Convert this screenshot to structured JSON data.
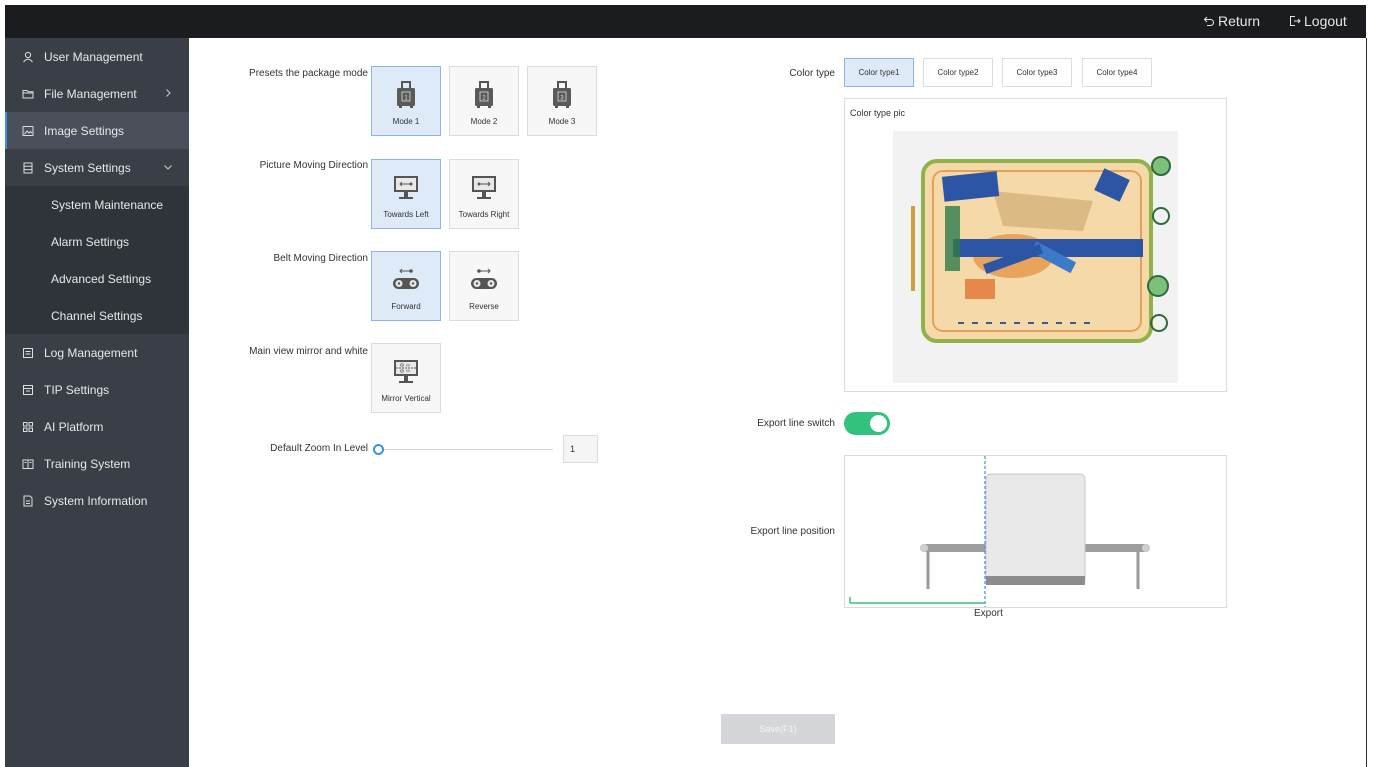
{
  "topbar": {
    "return_label": "Return",
    "logout_label": "Logout"
  },
  "sidebar": {
    "items": [
      {
        "label": "User Management",
        "icon": "user-icon"
      },
      {
        "label": "File Management",
        "icon": "folder-icon"
      },
      {
        "label": "Image Settings",
        "icon": "image-icon",
        "active": true
      },
      {
        "label": "System Settings",
        "icon": "list-icon",
        "expanded": true
      },
      {
        "label": "Log Management",
        "icon": "log-icon"
      },
      {
        "label": "TIP Settings",
        "icon": "tip-icon"
      },
      {
        "label": "AI Platform",
        "icon": "grid-icon"
      },
      {
        "label": "Training System",
        "icon": "book-icon"
      },
      {
        "label": "System Information",
        "icon": "info-icon"
      }
    ],
    "sub_items": [
      {
        "label": "System Maintenance"
      },
      {
        "label": "Alarm Settings"
      },
      {
        "label": "Advanced Settings"
      },
      {
        "label": "Channel Settings"
      }
    ]
  },
  "settings": {
    "package_mode": {
      "label": "Presets the package mode",
      "options": [
        {
          "label": "Mode 1",
          "selected": true
        },
        {
          "label": "Mode 2"
        },
        {
          "label": "Mode 3"
        }
      ]
    },
    "picture_direction": {
      "label": "Picture Moving Direction",
      "options": [
        {
          "label": "Towards Left",
          "selected": true
        },
        {
          "label": "Towards Right"
        }
      ]
    },
    "belt_direction": {
      "label": "Belt Moving Direction",
      "options": [
        {
          "label": "Forward",
          "selected": true
        },
        {
          "label": "Reverse"
        }
      ]
    },
    "mirror": {
      "label": "Main view mirror and white",
      "options": [
        {
          "label": "Mirror Vertical"
        }
      ]
    },
    "zoom": {
      "label": "Default Zoom In Level",
      "value": "1",
      "slider_fraction": 0
    },
    "color_type": {
      "label": "Color type",
      "options": [
        {
          "label": "Color type1",
          "selected": true
        },
        {
          "label": "Color type2"
        },
        {
          "label": "Color type3"
        },
        {
          "label": "Color type4"
        }
      ],
      "pic_title": "Color type pic"
    },
    "export_switch": {
      "label": "Export line switch",
      "on": true
    },
    "export_position": {
      "label": "Export line position",
      "caption": "Export"
    }
  },
  "save_label": "Save(F1)",
  "colors": {
    "accent": "#3c8df0",
    "toggle_on": "#33c17e",
    "sidebar_bg": "#3a3e46"
  }
}
